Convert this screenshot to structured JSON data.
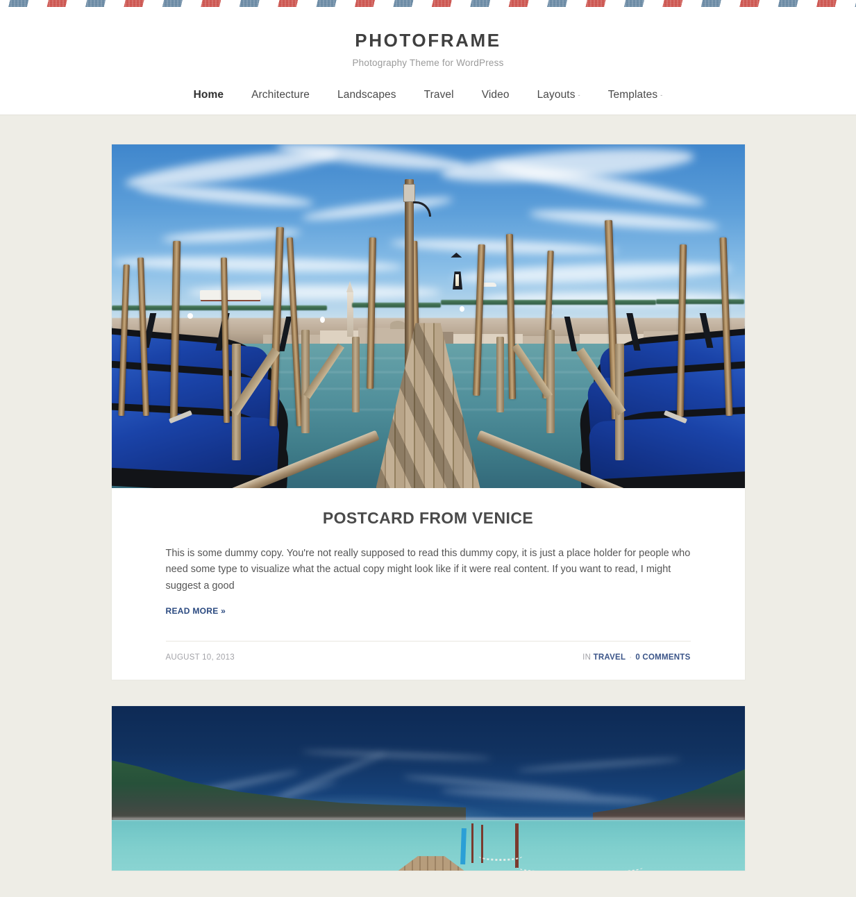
{
  "site": {
    "title": "PHOTOFRAME",
    "tagline": "Photography Theme for WordPress"
  },
  "nav": {
    "items": [
      {
        "label": "Home",
        "active": true,
        "caret": ""
      },
      {
        "label": "Architecture",
        "active": false,
        "caret": ""
      },
      {
        "label": "Landscapes",
        "active": false,
        "caret": ""
      },
      {
        "label": "Travel",
        "active": false,
        "caret": ""
      },
      {
        "label": "Video",
        "active": false,
        "caret": ""
      },
      {
        "label": "Layouts",
        "active": false,
        "caret": "-"
      },
      {
        "label": "Templates",
        "active": false,
        "caret": "-"
      }
    ]
  },
  "posts": [
    {
      "title": "POSTCARD FROM VENICE",
      "excerpt": "This is some dummy copy. You're not really supposed to read this dummy copy, it is just a place holder for people who need some type to visualize what the actual copy might look like if it were real content. If you want to read, I might suggest a good",
      "read_more": "READ MORE »",
      "date": "AUGUST 10, 2013",
      "in_label": "IN",
      "category": "TRAVEL",
      "separator": "·",
      "comments": "0 COMMENTS",
      "image_alt": "Wooden dock with blue gondolas moored in Venice lagoon, San Giorgio Maggiore church across the water"
    },
    {
      "image_alt": "Long exposure coastal bay at dusk with green cliffs, turquoise water and a wooden pier with rope railing"
    }
  ],
  "colors": {
    "page_background": "#eeede6",
    "card_background": "#ffffff",
    "title_text": "#4a4a4a",
    "body_text": "#555555",
    "link_blue": "#2b4a80",
    "meta_gray": "#a3a3a8",
    "stripe_red": "#c8453f",
    "stripe_blue": "#5d7f9c"
  }
}
